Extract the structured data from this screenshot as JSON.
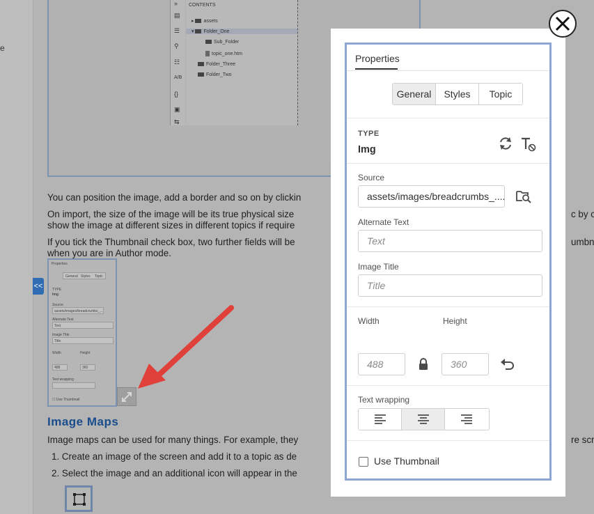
{
  "background_doc": {
    "edge_char": "e",
    "contents_title": "CONTENTS",
    "tree": [
      {
        "label": "assets"
      },
      {
        "label": "Folder_One"
      },
      {
        "label": "Sub_Folder"
      },
      {
        "label": "topic_one.htm"
      },
      {
        "label": "Folder_Three"
      },
      {
        "label": "Folder_Two"
      }
    ],
    "toolbar_glyphs": [
      "»",
      "▤",
      "☰",
      "⚲",
      "☷",
      "A/B",
      "{}",
      "▣",
      "⇆"
    ],
    "para1": "You can position the image, add a border and so on by clickin",
    "para2_line1": "On import, the size of the image will be its true physical size",
    "para2_line1_right": "c by ch",
    "para2_line2": "show the image at different sizes in different topics if require",
    "para3_line1": "If you tick the Thumbnail check box, two further fields will be",
    "para3_line1_right": "umbn",
    "para3_line2": "when you are in Author mode.",
    "collapse_label": "<<",
    "section_heading": "Image Maps",
    "section_para": "Image maps can be used for many things. For example, they",
    "section_para_right": "re scr",
    "list": [
      "1. Create an image of the screen and add it to a topic as de",
      "2. Select the image and an additional icon will appear in the"
    ],
    "thumbnail": {
      "title": "Properties",
      "tabs": [
        "General",
        "Styles",
        "Topic"
      ],
      "type_label": "TYPE",
      "type_value": "Img",
      "source_label": "Source",
      "source_value": "assets/images/breadcrumbs_...",
      "alt_label": "Alternate Text",
      "alt_ph": "Text",
      "title_label": "Image Title",
      "title_ph": "Title",
      "width_label": "Width",
      "height_label": "Height",
      "width_ph": "488",
      "height_ph": "360",
      "wrap_label": "Text wrapping",
      "use_thumb": "Use Thumbnail"
    }
  },
  "panel": {
    "header": "Properties",
    "tabs": [
      {
        "label": "General",
        "active": true
      },
      {
        "label": "Styles",
        "active": false
      },
      {
        "label": "Topic",
        "active": false
      }
    ],
    "type_label": "TYPE",
    "type_value": "Img",
    "source_label": "Source",
    "source_value": "assets/images/breadcrumbs_....",
    "alt_text_label": "Alternate Text",
    "alt_text_placeholder": "Text",
    "image_title_label": "Image Title",
    "image_title_placeholder": "Title",
    "width_label": "Width",
    "height_label": "Height",
    "width_placeholder": "488",
    "height_placeholder": "360",
    "text_wrapping_label": "Text wrapping",
    "wrap_options": [
      {
        "name": "align-left",
        "active": false
      },
      {
        "name": "align-center",
        "active": true
      },
      {
        "name": "align-right",
        "active": false
      }
    ],
    "use_thumbnail_label": "Use Thumbnail",
    "use_thumbnail_checked": false
  },
  "colors": {
    "panel_border": "#8aa6d1",
    "heading_blue": "#1a4d8c",
    "arrow_red": "#e0403a",
    "collapse_tab": "#2f6cb3"
  }
}
